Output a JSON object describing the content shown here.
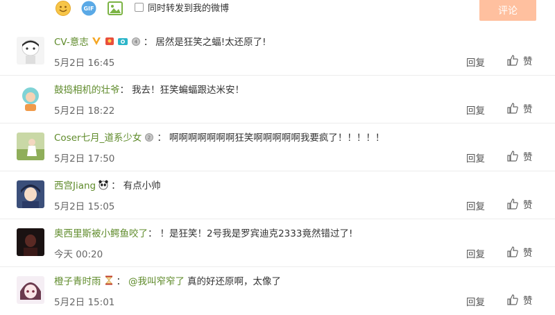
{
  "composer": {
    "icons": [
      "emoji-icon",
      "gif-icon",
      "image-icon"
    ],
    "gif_text": "GIF",
    "forward_label": "同时转发到我的微博",
    "submit_label": "评论"
  },
  "comments": [
    {
      "username": "CV-意志",
      "badges": [
        "vip-v-icon",
        "red-packet-icon",
        "camera-icon",
        "medal-icon"
      ],
      "text": "居然是狂笑之蝠!太还原了!",
      "mention": "",
      "time": "5月2日 16:45",
      "reply_label": "回复",
      "like_label": "赞"
    },
    {
      "username": "鼓捣相机的壮爷",
      "badges": [],
      "text": "我去！狂笑蝙蝠跟达米安！",
      "mention": "",
      "time": "5月2日 18:22",
      "reply_label": "回复",
      "like_label": "赞"
    },
    {
      "username": "Coser七月_道系少女",
      "badges": [
        "medal-icon"
      ],
      "text": "啊啊啊啊啊啊啊狂笑啊啊啊啊啊我要疯了！！！！！",
      "mention": "",
      "time": "5月2日 17:50",
      "reply_label": "回复",
      "like_label": "赞"
    },
    {
      "username": "西宫Jiang",
      "badges": [
        "panda-icon"
      ],
      "text": "有点小帅",
      "mention": "",
      "time": "5月2日 15:05",
      "reply_label": "回复",
      "like_label": "赞"
    },
    {
      "username": "奥西里斯被小鳄鱼咬了",
      "badges": [],
      "text": "！是狂笑！2号我是罗宾迪克2333竟然错过了!",
      "mention": "",
      "time": "今天 00:20",
      "reply_label": "回复",
      "like_label": "赞"
    },
    {
      "username": "橙子青时雨",
      "badges": [
        "hourglass-icon"
      ],
      "text": "真的好还原啊，太像了",
      "mention": "@我叫窄窄了",
      "time": "5月2日 15:01",
      "reply_label": "回复",
      "like_label": "赞"
    }
  ],
  "colors": {
    "username": "#5f8b2b",
    "submit_bg": "#ffc09f",
    "divider": "#ececec"
  }
}
